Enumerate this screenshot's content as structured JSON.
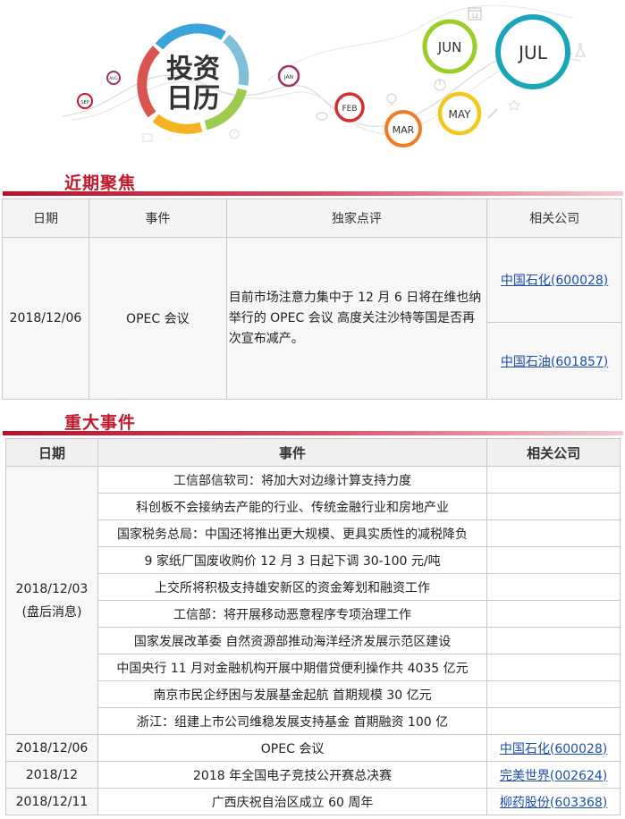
{
  "banner": {
    "logo_line1": "投资",
    "logo_line2": "日历",
    "months": [
      "SEP",
      "AUG",
      "JAN",
      "FEB",
      "MAR",
      "MAY",
      "JUN",
      "JUL"
    ],
    "calendar_day": "12"
  },
  "focus": {
    "title": "近期聚焦",
    "headers": [
      "日期",
      "事件",
      "独家点评",
      "相关公司"
    ],
    "row": {
      "date": "2018/12/06",
      "event": "OPEC 会议",
      "comment": "目前市场注意力集中于 12 月 6 日将在维也纳举行的 OPEC 会议 高度关注沙特等国是否再次宣布减产。",
      "companies": [
        "中国石化(600028)",
        "中国石油(601857)"
      ]
    }
  },
  "major": {
    "title": "重大事件",
    "headers": [
      "日期",
      "事件",
      "相关公司"
    ],
    "group_date": "2018/12/03",
    "group_note": "(盘后消息)",
    "group_events": [
      "工信部信软司：将加大对边缘计算支持力度",
      "科创板不会接纳去产能的行业、传统金融行业和房地产业",
      "国家税务总局：中国还将推出更大规模、更具实质性的减税降负",
      "9 家纸厂国废收购价 12 月 3 日起下调 30-100 元/吨",
      "上交所将积极支持雄安新区的资金筹划和融资工作",
      "工信部：将开展移动恶意程序专项治理工作",
      "国家发展改革委 自然资源部推动海洋经济发展示范区建设",
      "中国央行 11 月对金融机构开展中期借贷便利操作共 4035 亿元",
      "南京市民企纾困与发展基金起航 首期规模 30 亿元",
      "浙江：组建上市公司维稳发展支持基金 首期融资 100 亿"
    ],
    "rows": [
      {
        "date": "2018/12/06",
        "event": "OPEC 会议",
        "company": "中国石化(600028)"
      },
      {
        "date": "2018/12",
        "event": "2018 年全国电子竞技公开赛总决赛",
        "company": "完美世界(002624)"
      },
      {
        "date": "2018/12/11",
        "event": "广西庆祝自治区成立 60 周年",
        "company": "柳药股份(603368)"
      }
    ]
  },
  "colors": {
    "accent": "#c0192c",
    "link": "#1f4ea8"
  }
}
